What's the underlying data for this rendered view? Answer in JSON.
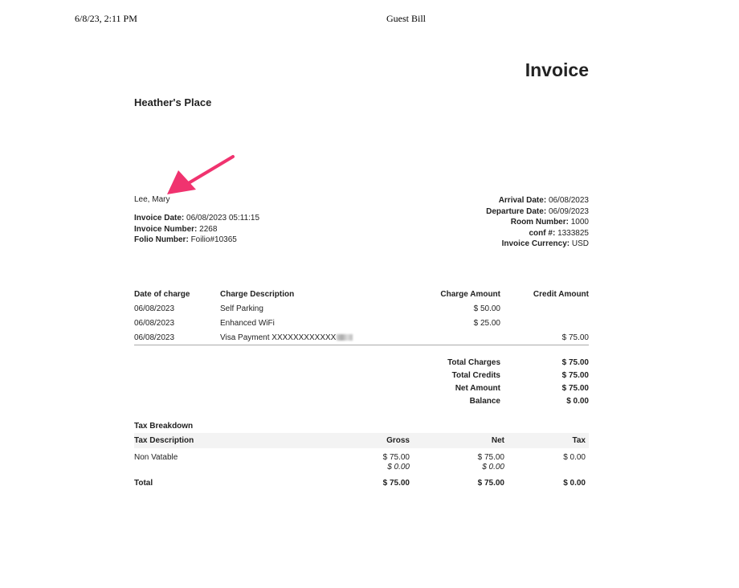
{
  "print_header": {
    "date": "6/8/23, 2:11 PM",
    "title": "Guest Bill"
  },
  "invoice_title": "Invoice",
  "hotel_name": "Heather's Place",
  "guest_name": "Lee, Mary",
  "left_info": [
    {
      "label": "Invoice Date:",
      "value": "06/08/2023 05:11:15"
    },
    {
      "label": "Invoice Number:",
      "value": "2268"
    },
    {
      "label": "Folio Number:",
      "value": "Foilio#10365"
    }
  ],
  "right_info": [
    {
      "label": "Arrival Date:",
      "value": "06/08/2023"
    },
    {
      "label": "Departure Date:",
      "value": "06/09/2023"
    },
    {
      "label": "Room Number:",
      "value": "1000"
    },
    {
      "label": "conf #:",
      "value": "1333825"
    },
    {
      "label": "Invoice Currency:",
      "value": "USD"
    }
  ],
  "charges": {
    "headers": [
      "Date of charge",
      "Charge Description",
      "Charge Amount",
      "Credit Amount"
    ],
    "rows": [
      {
        "date": "06/08/2023",
        "desc": "Self Parking",
        "charge": "$ 50.00",
        "credit": ""
      },
      {
        "date": "06/08/2023",
        "desc": "Enhanced WiFi",
        "charge": "$ 25.00",
        "credit": ""
      },
      {
        "date": "06/08/2023",
        "desc": "Visa Payment XXXXXXXXXXXX",
        "charge": "",
        "credit": "$ 75.00"
      }
    ]
  },
  "totals": [
    {
      "label": "Total Charges",
      "value": "$ 75.00"
    },
    {
      "label": "Total Credits",
      "value": "$ 75.00"
    },
    {
      "label": "Net Amount",
      "value": "$ 75.00"
    },
    {
      "label": "Balance",
      "value": "$ 0.00"
    }
  ],
  "tax": {
    "title": "Tax Breakdown",
    "headers": [
      "Tax Description",
      "Gross",
      "Net",
      "Tax"
    ],
    "row": {
      "desc": "Non Vatable",
      "gross": "$ 75.00",
      "gross_sub": "$ 0.00",
      "net": "$ 75.00",
      "net_sub": "$ 0.00",
      "tax": "$ 0.00"
    },
    "total": {
      "label": "Total",
      "gross": "$ 75.00",
      "net": "$ 75.00",
      "tax": "$ 0.00"
    }
  },
  "colors": {
    "arrow": "#f0336f",
    "tax_header_bg": "#f3f3f3"
  }
}
